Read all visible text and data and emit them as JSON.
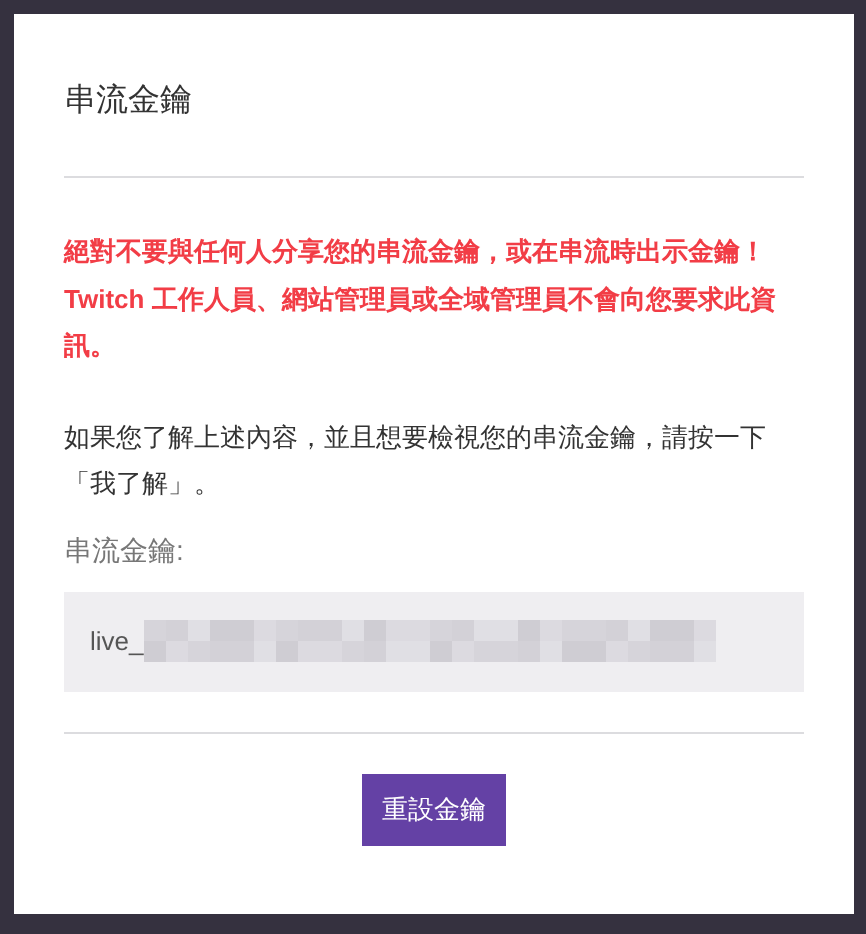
{
  "dialog": {
    "title": "串流金鑰",
    "warning": "絕對不要與任何人分享您的串流金鑰，或在串流時出示金鑰！Twitch 工作人員、網站管理員或全域管理員不會向您要求此資訊。",
    "instruction": "如果您了解上述內容，並且想要檢視您的串流金鑰，請按一下「我了解」。",
    "key_field": {
      "label": "串流金鑰:",
      "value": "live_",
      "redacted": true
    },
    "buttons": [
      {
        "label": "重設金鑰",
        "kind": "primary"
      }
    ]
  }
}
